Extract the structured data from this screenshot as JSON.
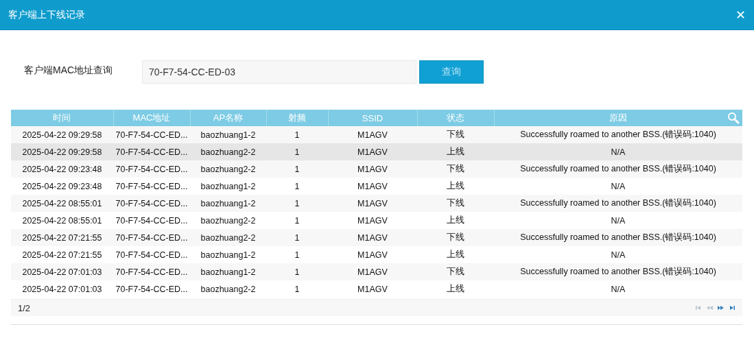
{
  "window": {
    "title": "客户端上下线记录",
    "close": "✕"
  },
  "search": {
    "label": "客户端MAC地址查询",
    "value": "70-F7-54-CC-ED-03",
    "button": "查询"
  },
  "table": {
    "columns": [
      "时间",
      "MAC地址",
      "AP名称",
      "射频",
      "SSID",
      "状态",
      "原因"
    ],
    "rows": [
      {
        "selected": false,
        "cells": [
          "2025-04-22 09:29:58",
          "70-F7-54-CC-ED...",
          "baozhuang1-2",
          "1",
          "M1AGV",
          "下线",
          "Successfully roamed to another BSS.(错误码:1040)"
        ]
      },
      {
        "selected": true,
        "cells": [
          "2025-04-22 09:29:58",
          "70-F7-54-CC-ED...",
          "baozhuang2-2",
          "1",
          "M1AGV",
          "上线",
          "N/A"
        ]
      },
      {
        "selected": false,
        "cells": [
          "2025-04-22 09:23:48",
          "70-F7-54-CC-ED...",
          "baozhuang2-2",
          "1",
          "M1AGV",
          "下线",
          "Successfully roamed to another BSS.(错误码:1040)"
        ]
      },
      {
        "selected": false,
        "cells": [
          "2025-04-22 09:23:48",
          "70-F7-54-CC-ED...",
          "baozhuang1-2",
          "1",
          "M1AGV",
          "上线",
          "N/A"
        ]
      },
      {
        "selected": false,
        "cells": [
          "2025-04-22 08:55:01",
          "70-F7-54-CC-ED...",
          "baozhuang1-2",
          "1",
          "M1AGV",
          "下线",
          "Successfully roamed to another BSS.(错误码:1040)"
        ]
      },
      {
        "selected": false,
        "cells": [
          "2025-04-22 08:55:01",
          "70-F7-54-CC-ED...",
          "baozhuang2-2",
          "1",
          "M1AGV",
          "上线",
          "N/A"
        ]
      },
      {
        "selected": false,
        "cells": [
          "2025-04-22 07:21:55",
          "70-F7-54-CC-ED...",
          "baozhuang2-2",
          "1",
          "M1AGV",
          "下线",
          "Successfully roamed to another BSS.(错误码:1040)"
        ]
      },
      {
        "selected": false,
        "cells": [
          "2025-04-22 07:21:55",
          "70-F7-54-CC-ED...",
          "baozhuang1-2",
          "1",
          "M1AGV",
          "上线",
          "N/A"
        ]
      },
      {
        "selected": false,
        "cells": [
          "2025-04-22 07:01:03",
          "70-F7-54-CC-ED...",
          "baozhuang1-2",
          "1",
          "M1AGV",
          "下线",
          "Successfully roamed to another BSS.(错误码:1040)"
        ]
      },
      {
        "selected": false,
        "cells": [
          "2025-04-22 07:01:03",
          "70-F7-54-CC-ED...",
          "baozhuang2-2",
          "1",
          "M1AGV",
          "上线",
          "N/A"
        ]
      }
    ]
  },
  "pager": {
    "page": "1/2",
    "buttons": [
      {
        "kind": "first",
        "disabled": true
      },
      {
        "kind": "prev",
        "disabled": true
      },
      {
        "kind": "next",
        "disabled": false
      },
      {
        "kind": "last",
        "disabled": false
      }
    ]
  }
}
